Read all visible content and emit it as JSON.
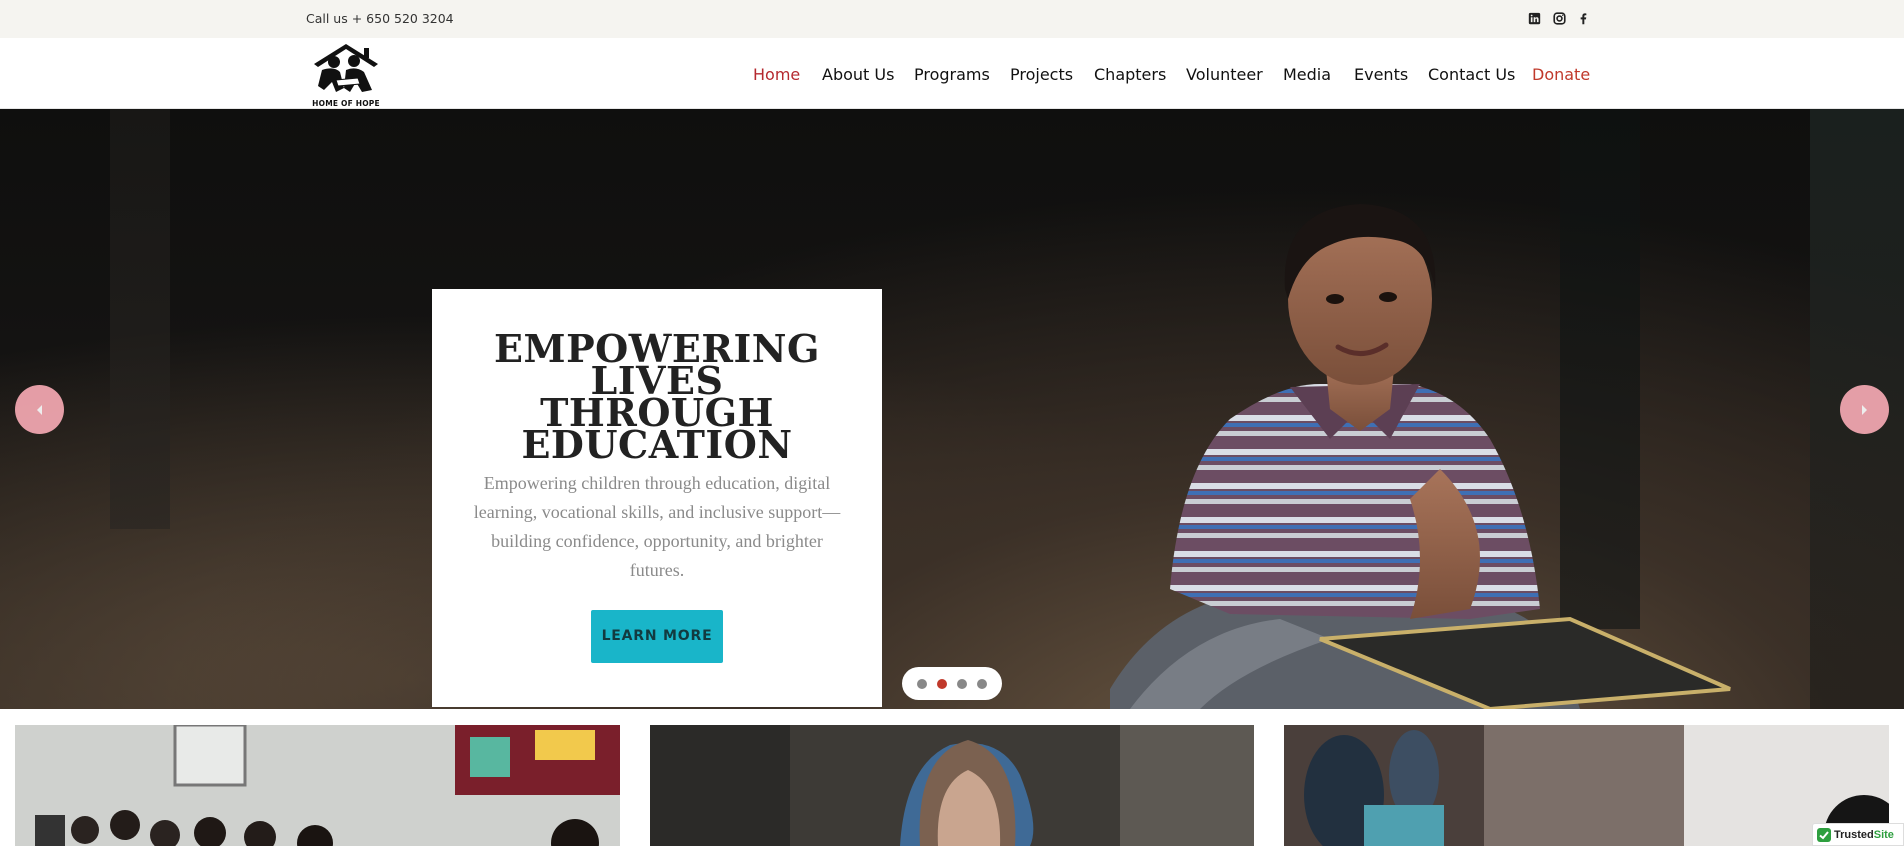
{
  "topbar": {
    "phone": "Call us + 650 520 3204",
    "social": [
      {
        "icon": "linkedin-icon"
      },
      {
        "icon": "instagram-icon"
      },
      {
        "icon": "facebook-icon"
      }
    ]
  },
  "header": {
    "logo_text": "HOME OF HOPE",
    "nav": [
      {
        "label": "Home",
        "active": true
      },
      {
        "label": "About Us"
      },
      {
        "label": "Programs"
      },
      {
        "label": "Projects"
      },
      {
        "label": "Chapters"
      },
      {
        "label": "Volunteer"
      },
      {
        "label": "Media"
      },
      {
        "label": "Events"
      },
      {
        "label": "Contact Us"
      },
      {
        "label": "Donate",
        "highlight": true
      }
    ]
  },
  "hero": {
    "title_lines": [
      "EMPOWERING LIVES",
      "THROUGH",
      "EDUCATION"
    ],
    "description": "Empowering children through education, digital learning, vocational skills, and inclusive support—building confidence, opportunity, and brighter futures.",
    "button_label": "LEARN MORE",
    "slides_total": 4,
    "active_slide": 2,
    "arrow_icons": [
      "arrow-left-icon",
      "arrow-right-icon"
    ]
  },
  "badge": {
    "brand": "Trusted",
    "brand_suffix": "Site"
  },
  "colors": {
    "accent": "#19b5c9",
    "active_nav": "#b5292f",
    "donate": "#c0392b",
    "arrow_bg": "#f5a9b3",
    "topbar_bg": "#f5f4f0"
  }
}
